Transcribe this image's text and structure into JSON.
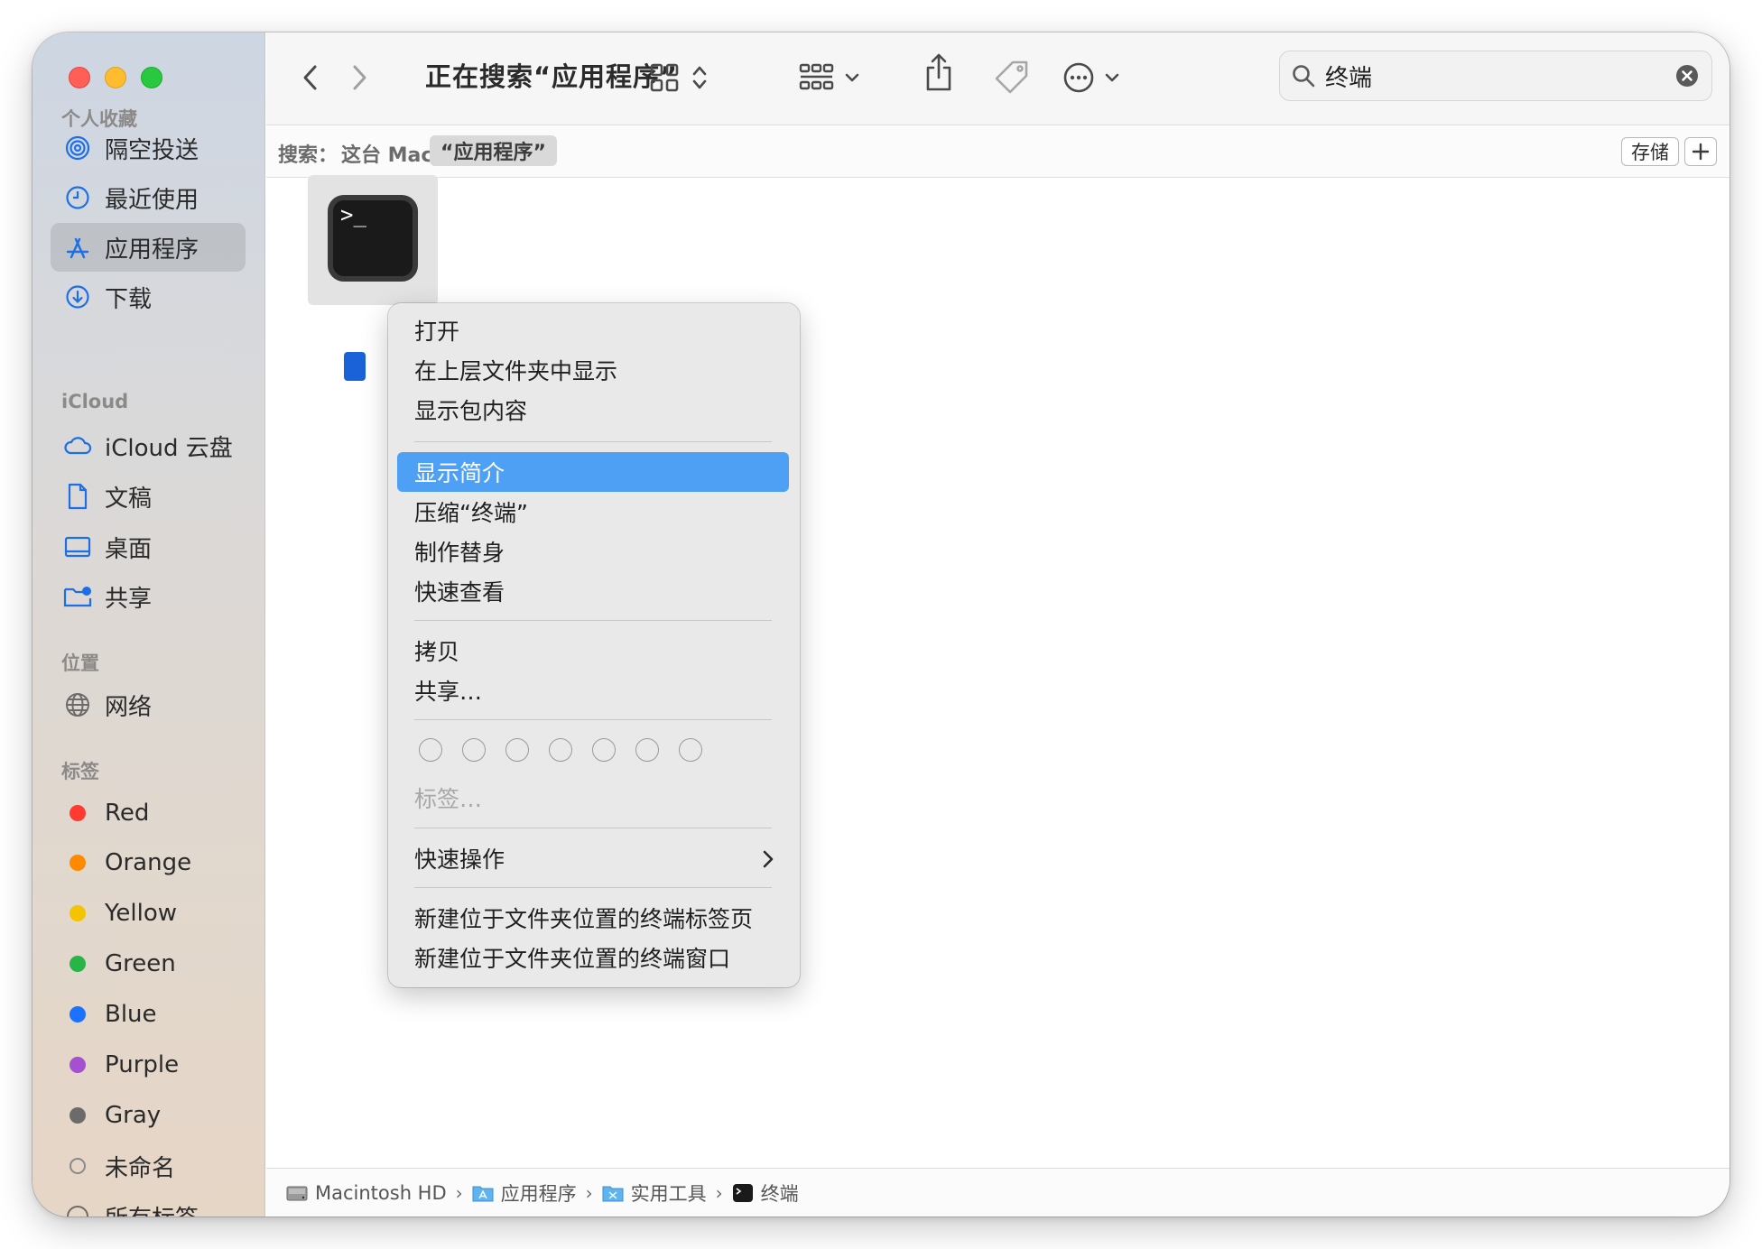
{
  "window": {
    "title": "正在搜索“应用程序”"
  },
  "sidebar": {
    "sections": [
      {
        "label": "个人收藏",
        "items": [
          {
            "label": "隔空投送",
            "icon": "airdrop-icon"
          },
          {
            "label": "最近使用",
            "icon": "clock-icon"
          },
          {
            "label": "应用程序",
            "icon": "applications-icon",
            "selected": true
          },
          {
            "label": "下载",
            "icon": "download-icon"
          }
        ]
      },
      {
        "label": "iCloud",
        "items": [
          {
            "label": "iCloud 云盘",
            "icon": "cloud-icon"
          },
          {
            "label": "文稿",
            "icon": "document-icon"
          },
          {
            "label": "桌面",
            "icon": "desktop-icon"
          },
          {
            "label": "共享",
            "icon": "shared-folder-icon"
          }
        ]
      },
      {
        "label": "位置",
        "items": [
          {
            "label": "网络",
            "icon": "globe-icon"
          }
        ]
      },
      {
        "label": "标签",
        "items": [
          {
            "label": "Red",
            "color": "#ff3b30"
          },
          {
            "label": "Orange",
            "color": "#ff8a00"
          },
          {
            "label": "Yellow",
            "color": "#f5c400"
          },
          {
            "label": "Green",
            "color": "#28b446"
          },
          {
            "label": "Blue",
            "color": "#1a72ff"
          },
          {
            "label": "Purple",
            "color": "#a550d0"
          },
          {
            "label": "Gray",
            "color": "#6b6b6b"
          },
          {
            "label": "未命名",
            "color": "hollow"
          },
          {
            "label": "所有标签…",
            "icon": "all-tags-icon"
          }
        ]
      }
    ]
  },
  "toolbar": {
    "search_value": "终端"
  },
  "scope": {
    "label": "搜索：",
    "this_mac": "这台 Mac",
    "apps": "“应用程序”",
    "save": "存储"
  },
  "context_menu": {
    "items": [
      "打开",
      "在上层文件夹中显示",
      "显示包内容",
      "显示简介",
      "压缩“终端”",
      "制作替身",
      "快速查看",
      "拷贝",
      "共享…",
      "标签…",
      "快速操作",
      "新建位于文件夹位置的终端标签页",
      "新建位于文件夹位置的终端窗口"
    ],
    "highlighted": "显示简介"
  },
  "pathbar": {
    "segments": [
      "Macintosh HD",
      "应用程序",
      "实用工具",
      "终端"
    ]
  },
  "colors": {
    "accent": "#4ea0f5",
    "selection_label": "#1a62d8"
  }
}
